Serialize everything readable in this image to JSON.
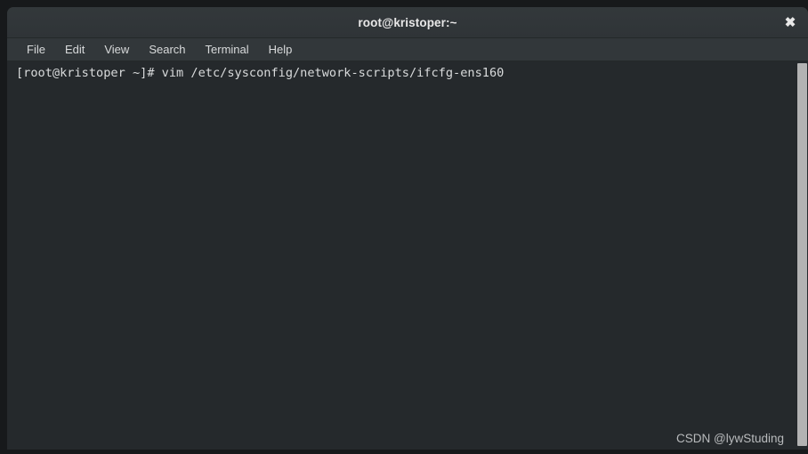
{
  "window": {
    "title": "root@kristoper:~",
    "close_label": "✖"
  },
  "menu": {
    "items": [
      {
        "label": "File"
      },
      {
        "label": "Edit"
      },
      {
        "label": "View"
      },
      {
        "label": "Search"
      },
      {
        "label": "Terminal"
      },
      {
        "label": "Help"
      }
    ]
  },
  "terminal": {
    "prompt": "[root@kristoper ~]#",
    "command": "vim /etc/sysconfig/network-scripts/ifcfg-ens160",
    "line": "[root@kristoper ~]# vim /etc/sysconfig/network-scripts/ifcfg-ens160"
  },
  "watermark": {
    "text": "CSDN @lywStuding"
  },
  "colors": {
    "title_bar": "#32373a",
    "menu_bar": "#32373a",
    "terminal_background": "#25292c",
    "terminal_foreground": "#d9dbdc",
    "scrollbar_thumb": "#b3b3b3",
    "desktop_background": "#17191b"
  }
}
